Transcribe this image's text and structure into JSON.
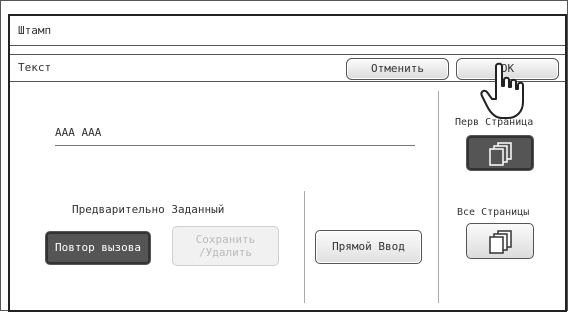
{
  "window": {
    "title": "Штамп"
  },
  "header": {
    "label": "Текст",
    "cancel_label": "Отменить",
    "ok_label": "OK"
  },
  "text_field": {
    "value": "AAA AAA"
  },
  "preset": {
    "label": "Предварительно Заданный",
    "recall_label": "Повтор вызова",
    "save_delete_line1": "Сохранить",
    "save_delete_line2": "/Удалить"
  },
  "direct_entry_label": "Прямой Ввод",
  "pages": {
    "first_page_label": "Перв Страница",
    "all_pages_label": "Все Страницы",
    "selected": "first_page"
  },
  "icons": {
    "first_page": "pages-stack-icon",
    "all_pages": "pages-stack-icon",
    "cursor": "hand-pointer-icon"
  }
}
